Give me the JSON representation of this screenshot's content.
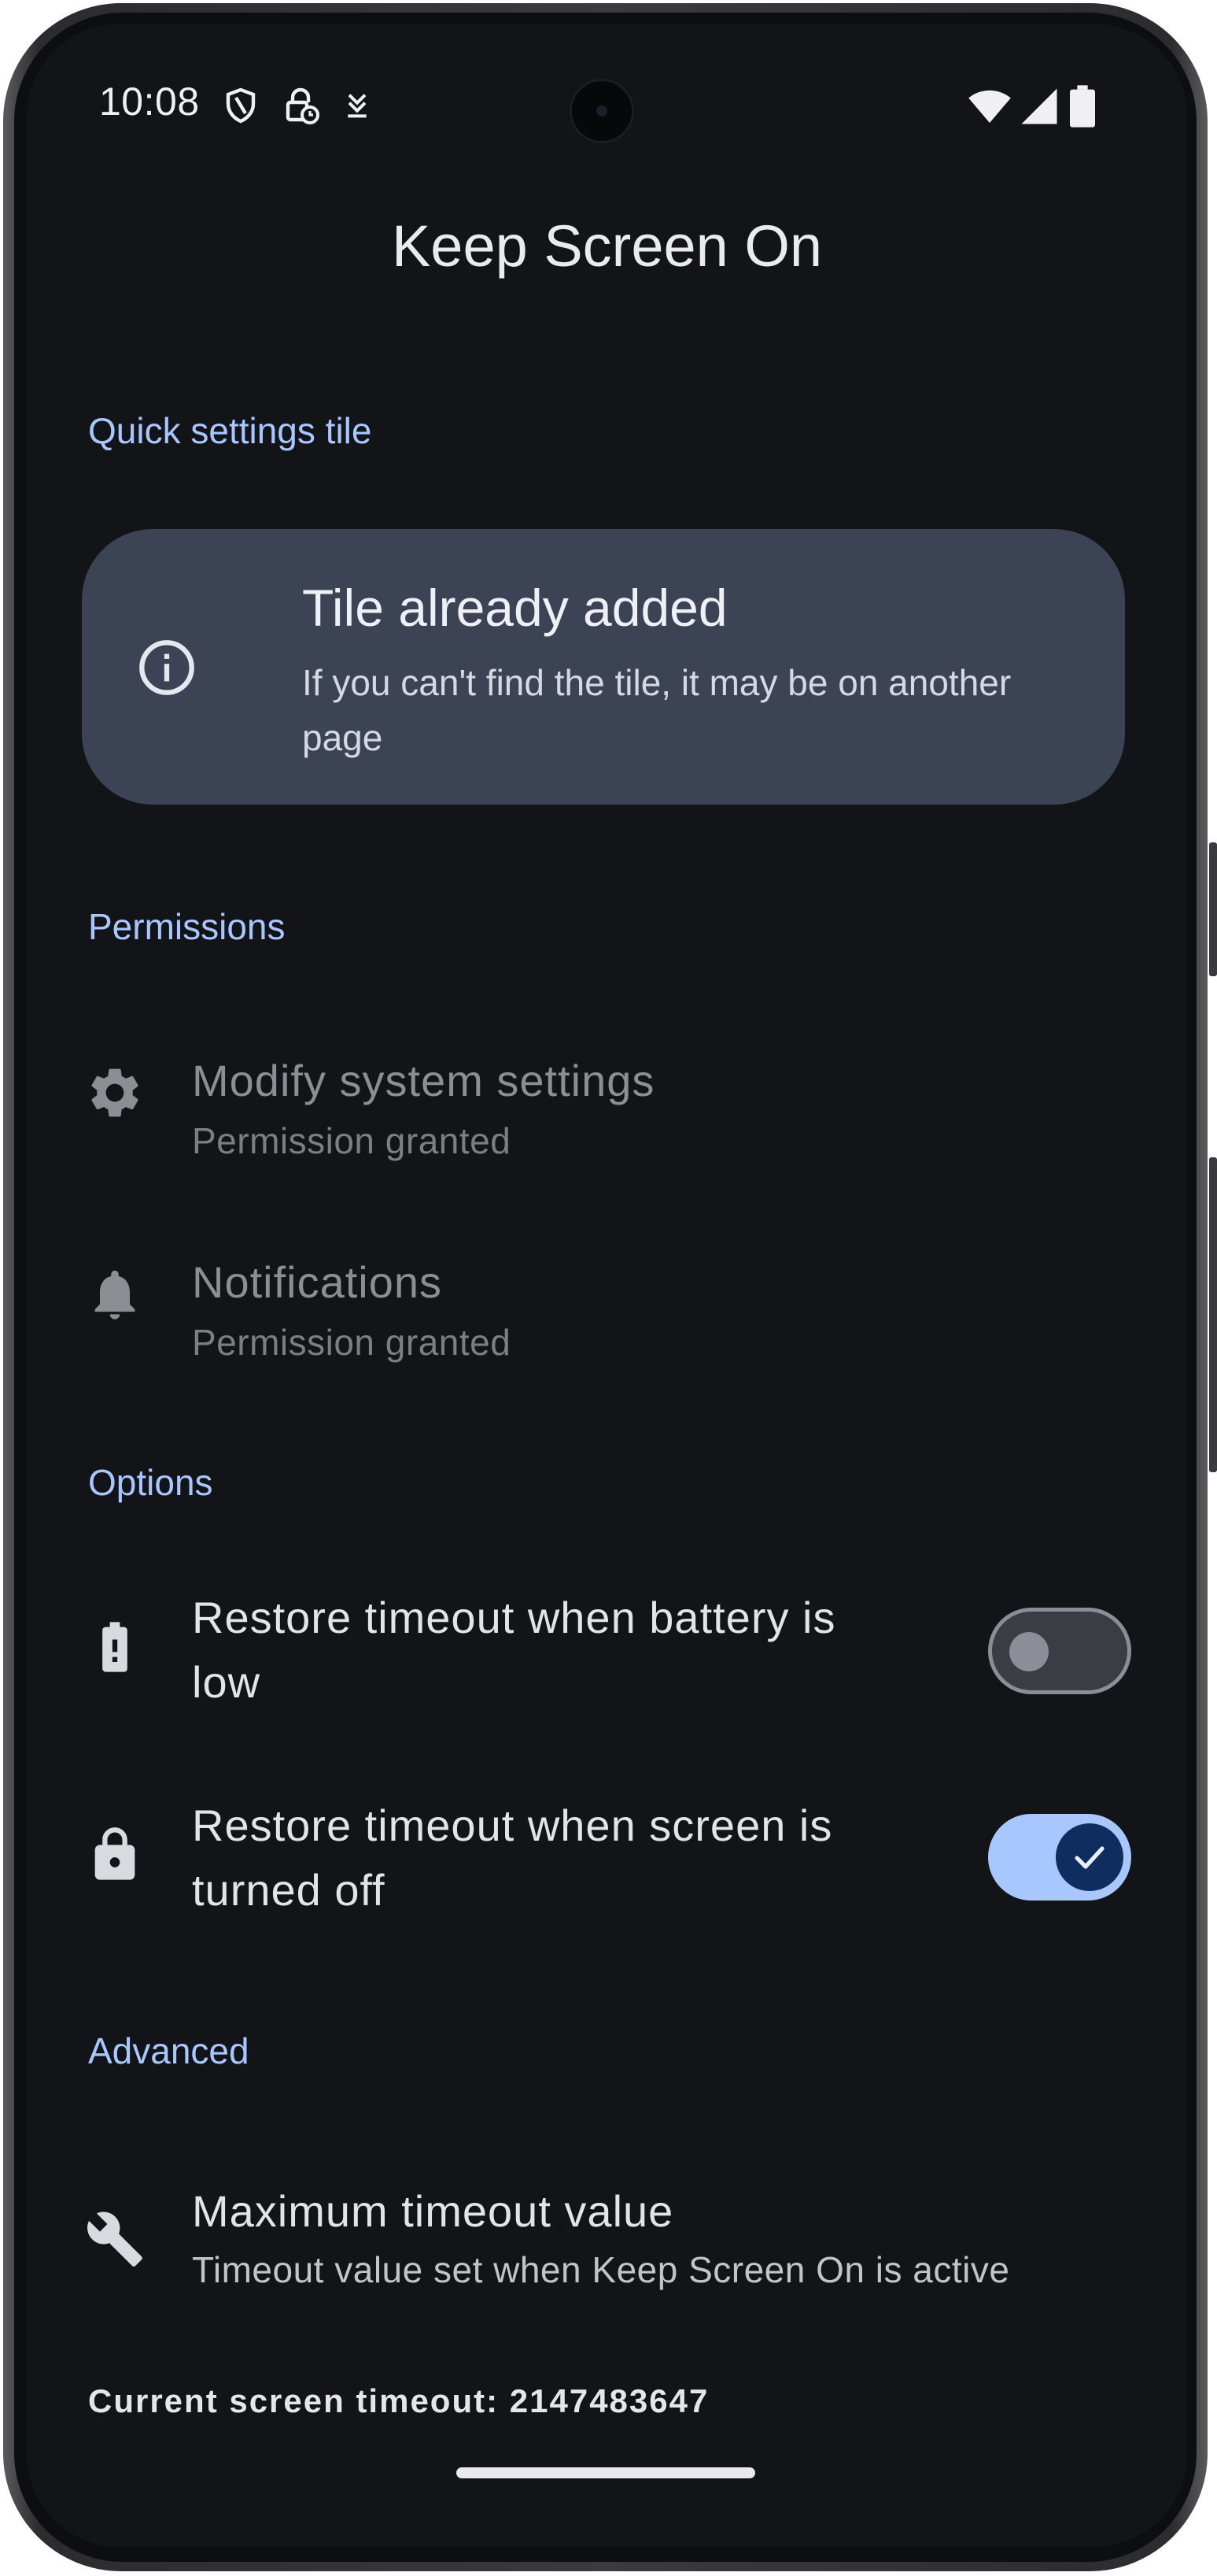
{
  "status_bar": {
    "time": "10:08",
    "icons": [
      "shield-icon",
      "lock-clock-icon",
      "download-icon",
      "wifi-icon",
      "signal-icon",
      "battery-icon"
    ]
  },
  "app": {
    "title": "Keep Screen On"
  },
  "quick_settings": {
    "header": "Quick settings tile",
    "card": {
      "icon": "info-icon",
      "title": "Tile already added",
      "subtitle": "If you can't find the tile, it may be on another page"
    }
  },
  "permissions": {
    "header": "Permissions",
    "items": [
      {
        "icon": "gear-icon",
        "title": "Modify system settings",
        "subtitle": "Permission granted"
      },
      {
        "icon": "bell-icon",
        "title": "Notifications",
        "subtitle": "Permission granted"
      }
    ]
  },
  "options": {
    "header": "Options",
    "items": [
      {
        "icon": "battery-alert-icon",
        "title": "Restore timeout when battery is low",
        "enabled": false
      },
      {
        "icon": "lock-icon",
        "title": "Restore timeout when screen is turned off",
        "enabled": true
      }
    ]
  },
  "advanced": {
    "header": "Advanced",
    "items": [
      {
        "icon": "wrench-icon",
        "title": "Maximum timeout value",
        "subtitle": "Timeout value set when Keep Screen On is active"
      }
    ]
  },
  "footer": {
    "current_timeout": "Current screen timeout: 2147483647"
  },
  "colors": {
    "background": "#131418",
    "accent": "#a9c7ff",
    "card": "#3c4354"
  }
}
